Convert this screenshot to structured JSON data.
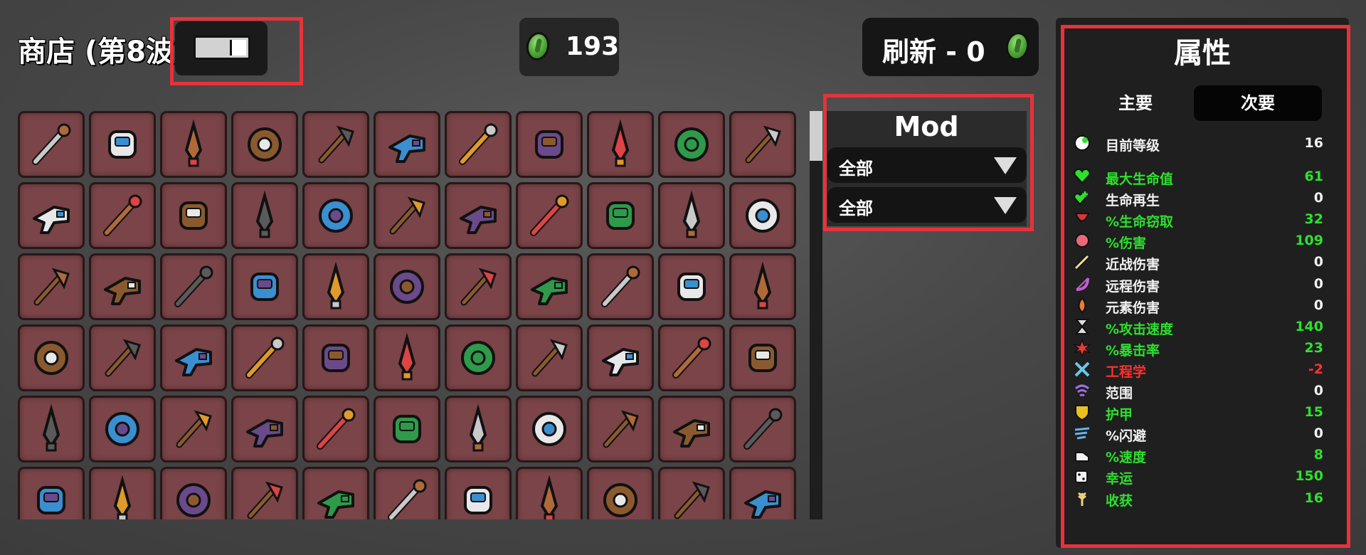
{
  "header": {
    "shop_title": "商店 (第8波)",
    "gold": "193",
    "reroll_label": "刷新 - 0"
  },
  "item_grid": {
    "rows": 6,
    "columns": 11,
    "cell_color": "#7a4448",
    "items": [
      "spiked-club-icon",
      "saw-blade-icon",
      "knife-icon",
      "fist-icon",
      "fire-fist-icon",
      "crystal-leaf-icon",
      "stone-axe-icon",
      "hand-chop-icon",
      "dagger-icon",
      "rock-icon",
      "scissors-icon",
      "screwdriver-icon",
      "spear-icon",
      "stick-icon",
      "sword-icon",
      "thunder-staff-icon",
      "torch-icon",
      "wrench-icon",
      "shotgun-icon",
      "turret-gun-icon",
      "scanner-gun-icon",
      "red-scanner-gun-icon",
      "minigun-icon",
      "blaster-icon",
      "bazooka-icon",
      "megaphone-gun-icon",
      "shuriken-icon",
      "slingshot-icon",
      "smg-icon",
      "taser-icon",
      "magic-wand-icon",
      "spectral-axe-icon",
      "skull-scepter-icon",
      "hatchet-icon",
      "cleaver-icon",
      "hydraulic-wrench-icon",
      "power-fist-icon",
      "spiked-shield-icon",
      "lightning-spear-icon",
      "laser-cannon-icon",
      "gatling-gauntlet-icon",
      "dragon-head-icon",
      "crossbow-icon",
      "plasma-cannon-icon",
      "wrapped-gauntlet-icon",
      "drill-spear-icon",
      "pruning-shears-icon",
      "revolver-icon",
      "gear-gun-icon",
      "flamethrower-icon",
      "claw-glove-icon",
      "short-sword-icon",
      "screwdriver-knife-icon",
      "scythe-icon",
      "plank-icon",
      "trident-icon",
      "ice-spear-icon",
      "lightning-rod-icon",
      "ice-blade-icon",
      "fire-bow-icon",
      "crystal-mace-icon",
      "golden-revolver-icon",
      "jade-crossbow-icon",
      "golden-sword-icon",
      "winged-blaster-icon",
      "ice-hammer-icon"
    ]
  },
  "mod_panel": {
    "title": "Mod",
    "dropdowns": [
      {
        "selected": "全部"
      },
      {
        "selected": "全部"
      }
    ]
  },
  "stats_panel": {
    "title": "属性",
    "tabs": [
      {
        "label": "主要",
        "active": false
      },
      {
        "label": "次要",
        "active": true
      }
    ],
    "rows": [
      {
        "icon": "level-icon",
        "name": "目前等级",
        "value": "16",
        "color": "white"
      },
      {
        "icon": "heart-icon",
        "name": "最大生命值",
        "value": "61",
        "color": "green"
      },
      {
        "icon": "regen-icon",
        "name": "生命再生",
        "value": "0",
        "color": "white"
      },
      {
        "icon": "lifesteal-icon",
        "name": "%生命窃取",
        "value": "32",
        "color": "green"
      },
      {
        "icon": "damage-icon",
        "name": "%伤害",
        "value": "109",
        "color": "green"
      },
      {
        "icon": "melee-icon",
        "name": "近战伤害",
        "value": "0",
        "color": "white"
      },
      {
        "icon": "ranged-icon",
        "name": "远程伤害",
        "value": "0",
        "color": "white"
      },
      {
        "icon": "elemental-icon",
        "name": "元素伤害",
        "value": "0",
        "color": "white"
      },
      {
        "icon": "attack-speed-icon",
        "name": "%攻击速度",
        "value": "140",
        "color": "green"
      },
      {
        "icon": "crit-icon",
        "name": "%暴击率",
        "value": "23",
        "color": "green"
      },
      {
        "icon": "engineering-icon",
        "name": "工程学",
        "value": "-2",
        "color": "red"
      },
      {
        "icon": "range-icon",
        "name": "范围",
        "value": "0",
        "color": "white"
      },
      {
        "icon": "armor-icon",
        "name": "护甲",
        "value": "15",
        "color": "green"
      },
      {
        "icon": "dodge-icon",
        "name": "%闪避",
        "value": "0",
        "color": "white"
      },
      {
        "icon": "speed-icon",
        "name": "%速度",
        "value": "8",
        "color": "green"
      },
      {
        "icon": "luck-icon",
        "name": "幸运",
        "value": "150",
        "color": "green"
      },
      {
        "icon": "harvest-icon",
        "name": "收获",
        "value": "16",
        "color": "green"
      }
    ]
  },
  "colors": {
    "highlight": "#e8323a",
    "positive": "#2ee02e",
    "negative": "#ff3030",
    "coin": "#4ca235"
  }
}
